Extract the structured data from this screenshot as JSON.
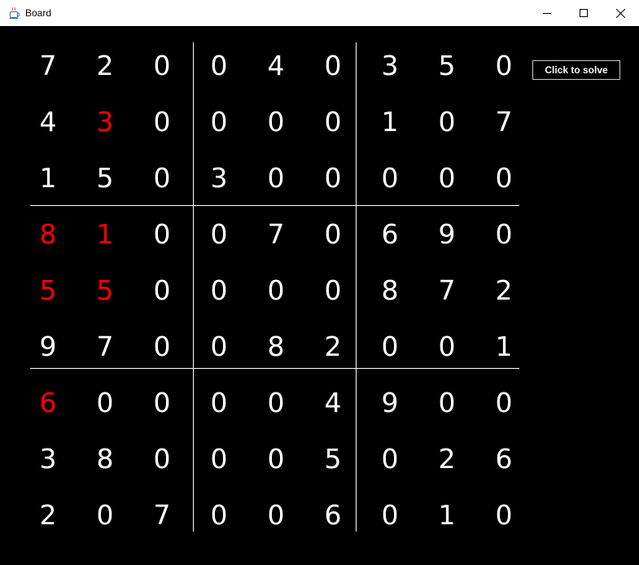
{
  "window": {
    "title": "Board",
    "icon": "java-coffee-icon",
    "controls": [
      "minimize-icon",
      "maximize-icon",
      "close-icon"
    ]
  },
  "solve_button": {
    "label": "Click to solve"
  },
  "board": {
    "rows": [
      [
        "7",
        "2",
        "0",
        "0",
        "4",
        "0",
        "3",
        "5",
        "0"
      ],
      [
        "4",
        "3",
        "0",
        "0",
        "0",
        "0",
        "1",
        "0",
        "7"
      ],
      [
        "1",
        "5",
        "0",
        "3",
        "0",
        "0",
        "0",
        "0",
        "0"
      ],
      [
        "8",
        "1",
        "0",
        "0",
        "7",
        "0",
        "6",
        "9",
        "0"
      ],
      [
        "5",
        "5",
        "0",
        "0",
        "0",
        "0",
        "8",
        "7",
        "2"
      ],
      [
        "9",
        "7",
        "0",
        "0",
        "8",
        "2",
        "0",
        "0",
        "1"
      ],
      [
        "6",
        "0",
        "0",
        "0",
        "0",
        "4",
        "9",
        "0",
        "0"
      ],
      [
        "3",
        "8",
        "0",
        "0",
        "0",
        "5",
        "0",
        "2",
        "6"
      ],
      [
        "2",
        "0",
        "7",
        "0",
        "0",
        "6",
        "0",
        "1",
        "0"
      ]
    ],
    "conflict_cells": [
      [
        1,
        1
      ],
      [
        3,
        0
      ],
      [
        3,
        1
      ],
      [
        4,
        0
      ],
      [
        4,
        1
      ],
      [
        6,
        0
      ]
    ],
    "colors": {
      "normal": "#ffffff",
      "conflict": "#ff0000",
      "background": "#000000"
    }
  }
}
